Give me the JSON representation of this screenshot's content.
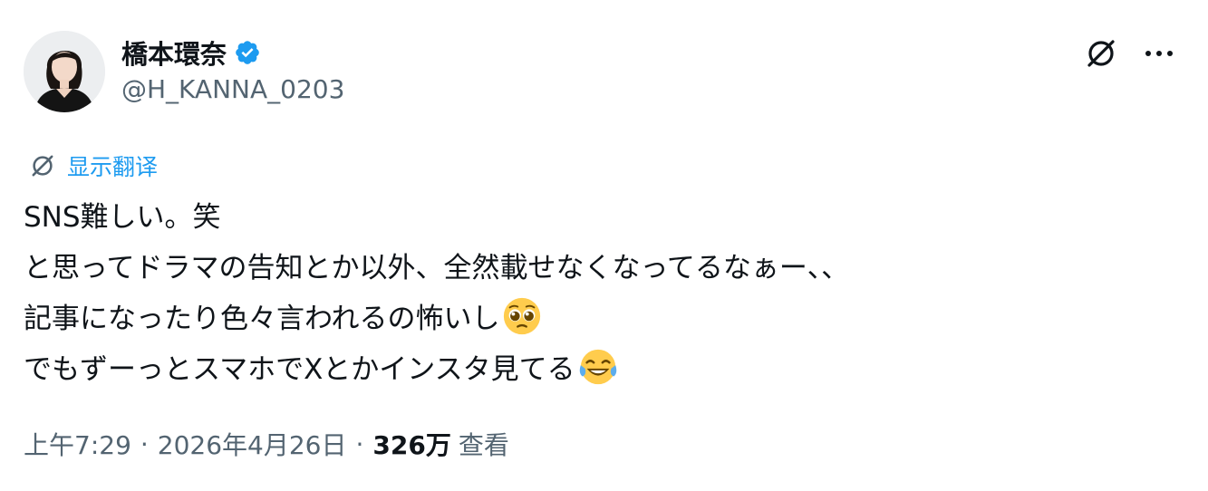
{
  "author": {
    "display_name": "橋本環奈",
    "handle": "@H_KANNA_0203",
    "verified": true
  },
  "header": {
    "grok_icon": "grok-slash-circle-icon",
    "more_icon": "more-horizontal-icon"
  },
  "translate": {
    "label": "显示翻译",
    "icon": "grok-slash-circle-icon"
  },
  "tweet": {
    "lines": [
      "SNS難しい。笑",
      "と思ってドラマの告知とか以外、全然載せなくなってるなぁー、、",
      "記事になったり色々言われるの怖いし",
      "でもずーっとスマホでXとかインスタ見てる"
    ],
    "emojis": [
      "pleading-face-emoji",
      "tears-of-joy-emoji"
    ]
  },
  "meta": {
    "time": "上午7:29",
    "date": "2026年4月26日",
    "views_count": "326万",
    "views_label": "查看"
  },
  "colors": {
    "accent": "#1d9bf0",
    "secondary_text": "#536471",
    "primary_text": "#0f1419"
  }
}
